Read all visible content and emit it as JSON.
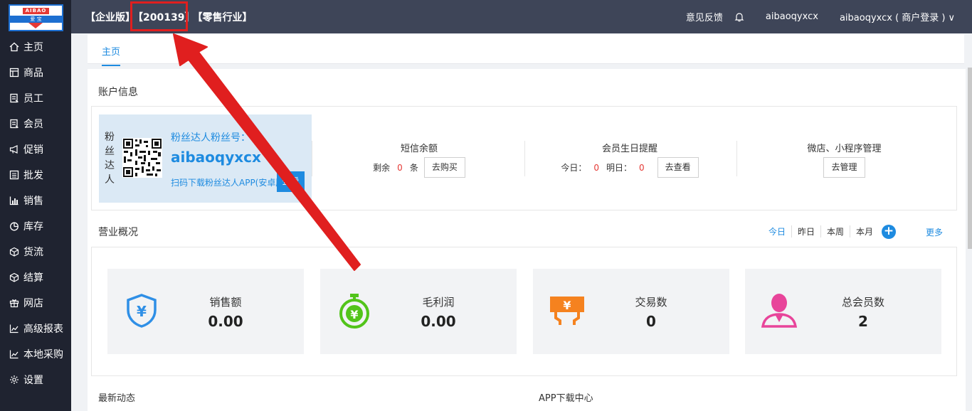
{
  "logo": {
    "top_text": "AIBAO",
    "mid_text": "爱 宝"
  },
  "sidebar": {
    "items": [
      {
        "label": "主页",
        "icon": "home-icon"
      },
      {
        "label": "商品",
        "icon": "goods-icon"
      },
      {
        "label": "员工",
        "icon": "staff-icon"
      },
      {
        "label": "会员",
        "icon": "member-icon"
      },
      {
        "label": "促销",
        "icon": "promotion-icon"
      },
      {
        "label": "批发",
        "icon": "wholesale-icon"
      },
      {
        "label": "销售",
        "icon": "sales-chart-icon"
      },
      {
        "label": "库存",
        "icon": "inventory-pie-icon"
      },
      {
        "label": "货流",
        "icon": "logistics-cube-icon"
      },
      {
        "label": "结算",
        "icon": "settlement-cube-icon"
      },
      {
        "label": "网店",
        "icon": "gift-shop-icon"
      },
      {
        "label": "高级报表",
        "icon": "report-line-icon"
      },
      {
        "label": "本地采购",
        "icon": "purchase-line-icon"
      },
      {
        "label": "设置",
        "icon": "gear-icon"
      }
    ]
  },
  "header": {
    "edition": "【企业版】",
    "account_id": "【200139】",
    "industry": "【零售行业】",
    "feedback": "意见反馈",
    "username": "aibaoqyxcx",
    "login_info": "aibaoqyxcx ( 商户登录 )",
    "chevron": "∨"
  },
  "tabs": {
    "home": "主页"
  },
  "account": {
    "section_title": "账户信息",
    "fans": {
      "vertical_label": [
        "粉",
        "丝",
        "达",
        "人"
      ],
      "title": "粉丝达人粉丝号：",
      "name": "aibaoqyxcx",
      "hint": "扫码下载粉丝达人APP(安卓版)",
      "button": "查看"
    },
    "sms": {
      "title": "短信余额",
      "prefix": "剩余",
      "count": "0",
      "suffix": "条",
      "button": "去购买"
    },
    "birthday": {
      "title": "会员生日提醒",
      "today_label": "今日：",
      "today": "0",
      "tomorrow_label": "明日：",
      "tomorrow": "0",
      "button": "去查看"
    },
    "miniapp": {
      "title": "微店、小程序管理",
      "button": "去管理"
    }
  },
  "business": {
    "section_title": "营业概况",
    "periods": [
      "今日",
      "昨日",
      "本周",
      "本月"
    ],
    "active_period": "今日",
    "more": "更多",
    "stats": [
      {
        "label": "销售额",
        "value": "0.00",
        "icon": "shield-yen-icon",
        "color": "#2f8fe6"
      },
      {
        "label": "毛利润",
        "value": "0.00",
        "icon": "stopwatch-yen-icon",
        "color": "#52c41a"
      },
      {
        "label": "交易数",
        "value": "0",
        "icon": "yen-ticket-icon",
        "color": "#f5821f"
      },
      {
        "label": "总会员数",
        "value": "2",
        "icon": "member-person-icon",
        "color": "#e8449a"
      }
    ]
  },
  "bottom": {
    "news_title": "最新动态",
    "app_title": "APP下载中心"
  },
  "colors": {
    "accent": "#1e8be0",
    "sidebar": "#1f2330",
    "topbar": "#3e4558",
    "annotation": "#e01f1f"
  }
}
